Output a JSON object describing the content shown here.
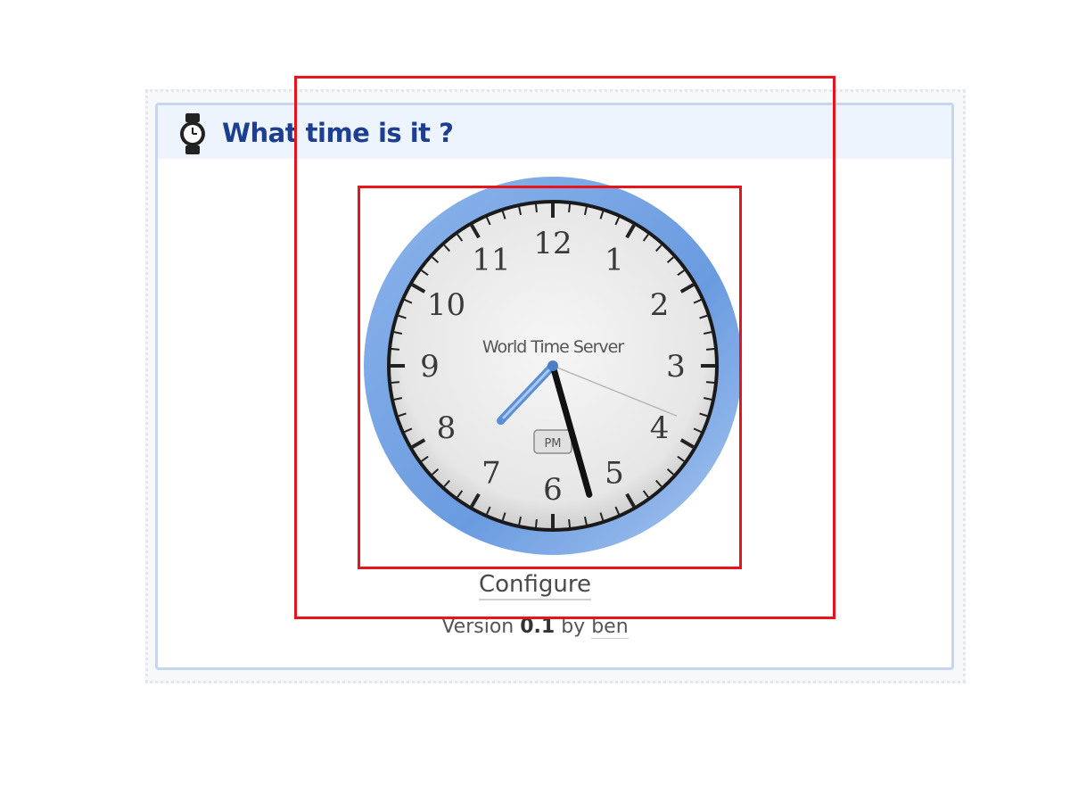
{
  "widget": {
    "title": "What time is it ?",
    "icon": "wristwatch-icon"
  },
  "clock": {
    "brand": "World Time Server",
    "badge": "PM",
    "numerals": [
      "12",
      "1",
      "2",
      "3",
      "4",
      "5",
      "6",
      "7",
      "8",
      "9",
      "10",
      "11"
    ],
    "time": {
      "hour": 7,
      "minute": 27,
      "second": 22
    },
    "colors": {
      "bezel": "#6fa0e0",
      "face": "#ececec",
      "hour_hand": "#5a8fd6",
      "minute_hand": "#111111"
    }
  },
  "footer": {
    "configure_label": "Configure",
    "version_prefix": "Version",
    "version_number": "0.1",
    "version_by": "by",
    "author": "ben"
  },
  "annotation_color": "#e8141c"
}
